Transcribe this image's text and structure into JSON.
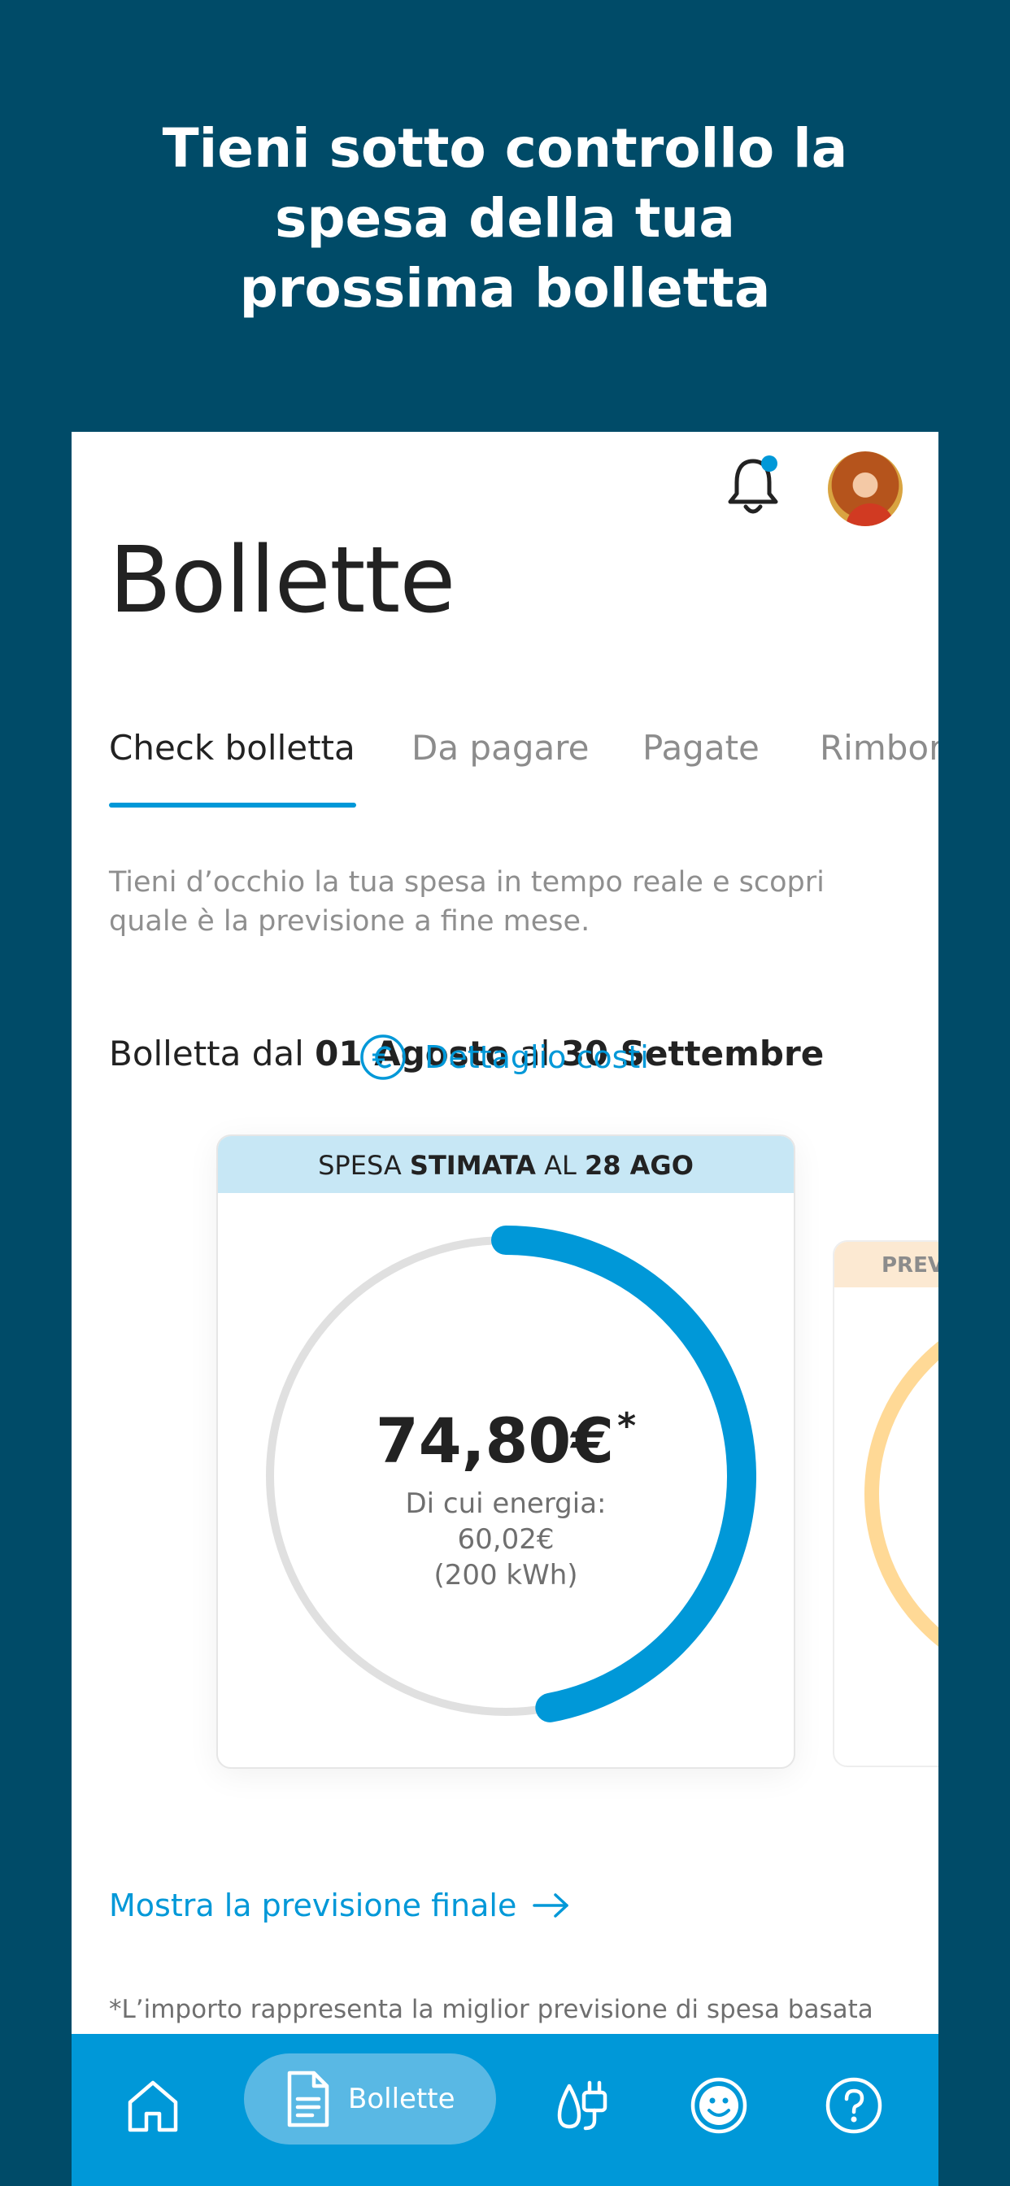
{
  "promo": {
    "line1": "Tieni sotto controllo la",
    "line2": "spesa della tua",
    "line3": "prossima bolletta"
  },
  "header": {
    "title": "Bollette"
  },
  "tabs": [
    {
      "label": "Check bolletta",
      "active": true
    },
    {
      "label": "Da pagare",
      "active": false
    },
    {
      "label": "Pagate",
      "active": false
    },
    {
      "label": "Rimbor",
      "active": false
    }
  ],
  "intro_text": "Tieni d’occhio la tua spesa in tempo reale e scopri quale è la previsione a fine mese.",
  "period": {
    "prefix": "Bolletta dal",
    "from": "01 Agosto",
    "joiner": "al",
    "to": "30 Settembre"
  },
  "estimate_card": {
    "header_prefix": "SPESA",
    "header_bold": "STIMATA",
    "header_mid": "AL",
    "header_date": "28 AGO",
    "amount": "74,80€",
    "amount_mark": "*",
    "energy_label": "Di cui energia:",
    "energy_value": "60,02€",
    "energy_kwh": "(200 kWh)",
    "progress_fraction": 0.47,
    "detail_label": "Dettaglio costi"
  },
  "forecast_card": {
    "header": "PREV"
  },
  "final_link": "Mostra la previsione finale",
  "footnote": "*L’importo rappresenta la miglior previsione di spesa basata",
  "bottom_nav": {
    "active_label": "Bollette"
  },
  "colors": {
    "brand_blue": "#0098D8",
    "dark_teal": "#004B68",
    "ring_track": "#E0E0E0",
    "forecast_orange": "#FFD996"
  }
}
